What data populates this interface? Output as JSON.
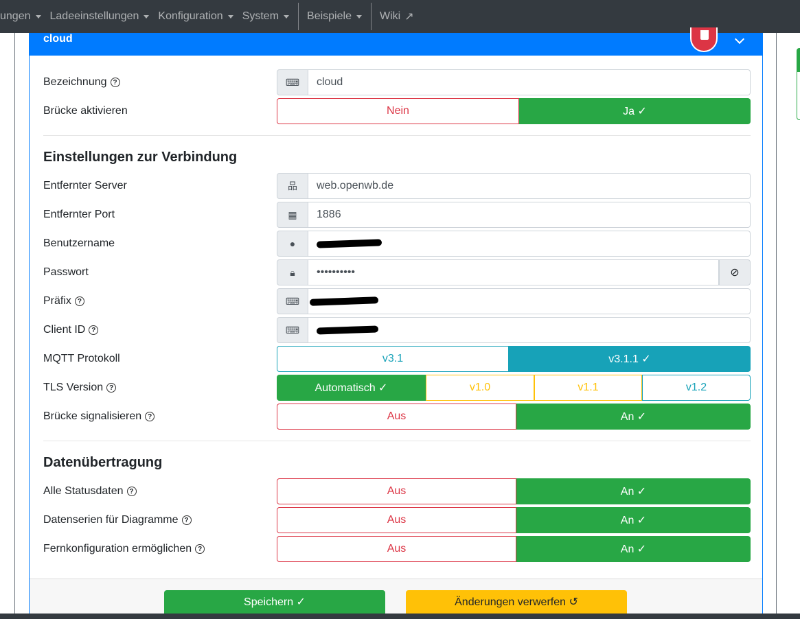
{
  "nav": {
    "items": [
      "ungen",
      "Ladeeinstellungen",
      "Konfiguration",
      "System",
      "Beispiele",
      "Wiki"
    ]
  },
  "card": {
    "title": "cloud"
  },
  "fields": {
    "bezeichnung": {
      "label": "Bezeichnung",
      "value": "cloud"
    },
    "bruecke": {
      "label": "Brücke aktivieren",
      "off": "Nein",
      "on": "Ja ✓"
    },
    "section1": "Einstellungen zur Verbindung",
    "server": {
      "label": "Entfernter Server",
      "value": "web.openwb.de"
    },
    "port": {
      "label": "Entfernter Port",
      "value": "1886"
    },
    "user": {
      "label": "Benutzername"
    },
    "password": {
      "label": "Passwort",
      "value": "••••••••••"
    },
    "prefix": {
      "label": "Präfix"
    },
    "clientid": {
      "label": "Client ID"
    },
    "mqtt": {
      "label": "MQTT Protokoll",
      "options": [
        "v3.1",
        "v3.1.1 ✓"
      ]
    },
    "tls": {
      "label": "TLS Version",
      "options": [
        "Automatisch ✓",
        "v1.0",
        "v1.1",
        "v1.2"
      ]
    },
    "signal": {
      "label": "Brücke signalisieren",
      "off": "Aus",
      "on": "An ✓"
    },
    "section2": "Datenübertragung",
    "status": {
      "label": "Alle Statusdaten",
      "off": "Aus",
      "on": "An ✓"
    },
    "series": {
      "label": "Datenserien für Diagramme",
      "off": "Aus",
      "on": "An ✓"
    },
    "remote": {
      "label": "Fernkonfiguration ermöglichen",
      "off": "Aus",
      "on": "An ✓"
    }
  },
  "footer": {
    "save": "Speichern ✓",
    "discard": "Änderungen verwerfen ↺"
  }
}
